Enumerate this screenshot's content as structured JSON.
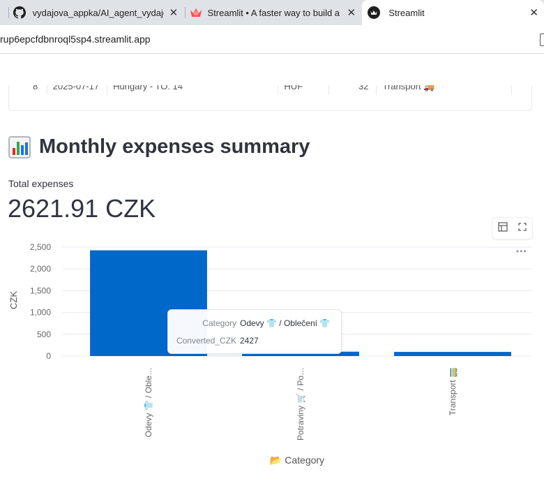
{
  "browser": {
    "tabs": [
      {
        "title": "vydajova_appka/AI_agent_vydajo",
        "icon": "github-icon"
      },
      {
        "title": "Streamlit • A faster way to build a",
        "icon": "streamlit-crown-icon"
      },
      {
        "title": "Streamlit",
        "icon": "streamlit-favicon",
        "active": true
      }
    ],
    "url": "rup6epcfdbnroql5sp4.streamlit.app"
  },
  "page": {
    "table_remnant": {
      "cells": [
        "8",
        "2025-07-17",
        "Hungary - TO. 14",
        "HUF",
        "32",
        "Transport 🚚"
      ]
    },
    "header": {
      "emoji": "chart-icon",
      "title": "Monthly expenses summary"
    },
    "metric": {
      "label": "Total expenses",
      "value": "2621.91 CZK"
    },
    "chart_tooltip": {
      "category_key": "Category",
      "category_value": "Odevy 👕 / Oblečení 👕",
      "amount_key": "Converted_CZK",
      "amount_value": "2427"
    }
  },
  "chart_data": {
    "type": "bar",
    "xlabel": "📂 Category",
    "ylabel": "CZK",
    "ylim": [
      0,
      2500
    ],
    "yticks": [
      "0",
      "500",
      "1,000",
      "1,500",
      "2,000",
      "2,500"
    ],
    "categories": [
      "Odevy 👕 / Oble…",
      "Potraviny 🛒 / Po…",
      "Transport 🚃"
    ],
    "values": [
      2427,
      100,
      95
    ],
    "bar_color": "#0068c9",
    "grid": true
  }
}
